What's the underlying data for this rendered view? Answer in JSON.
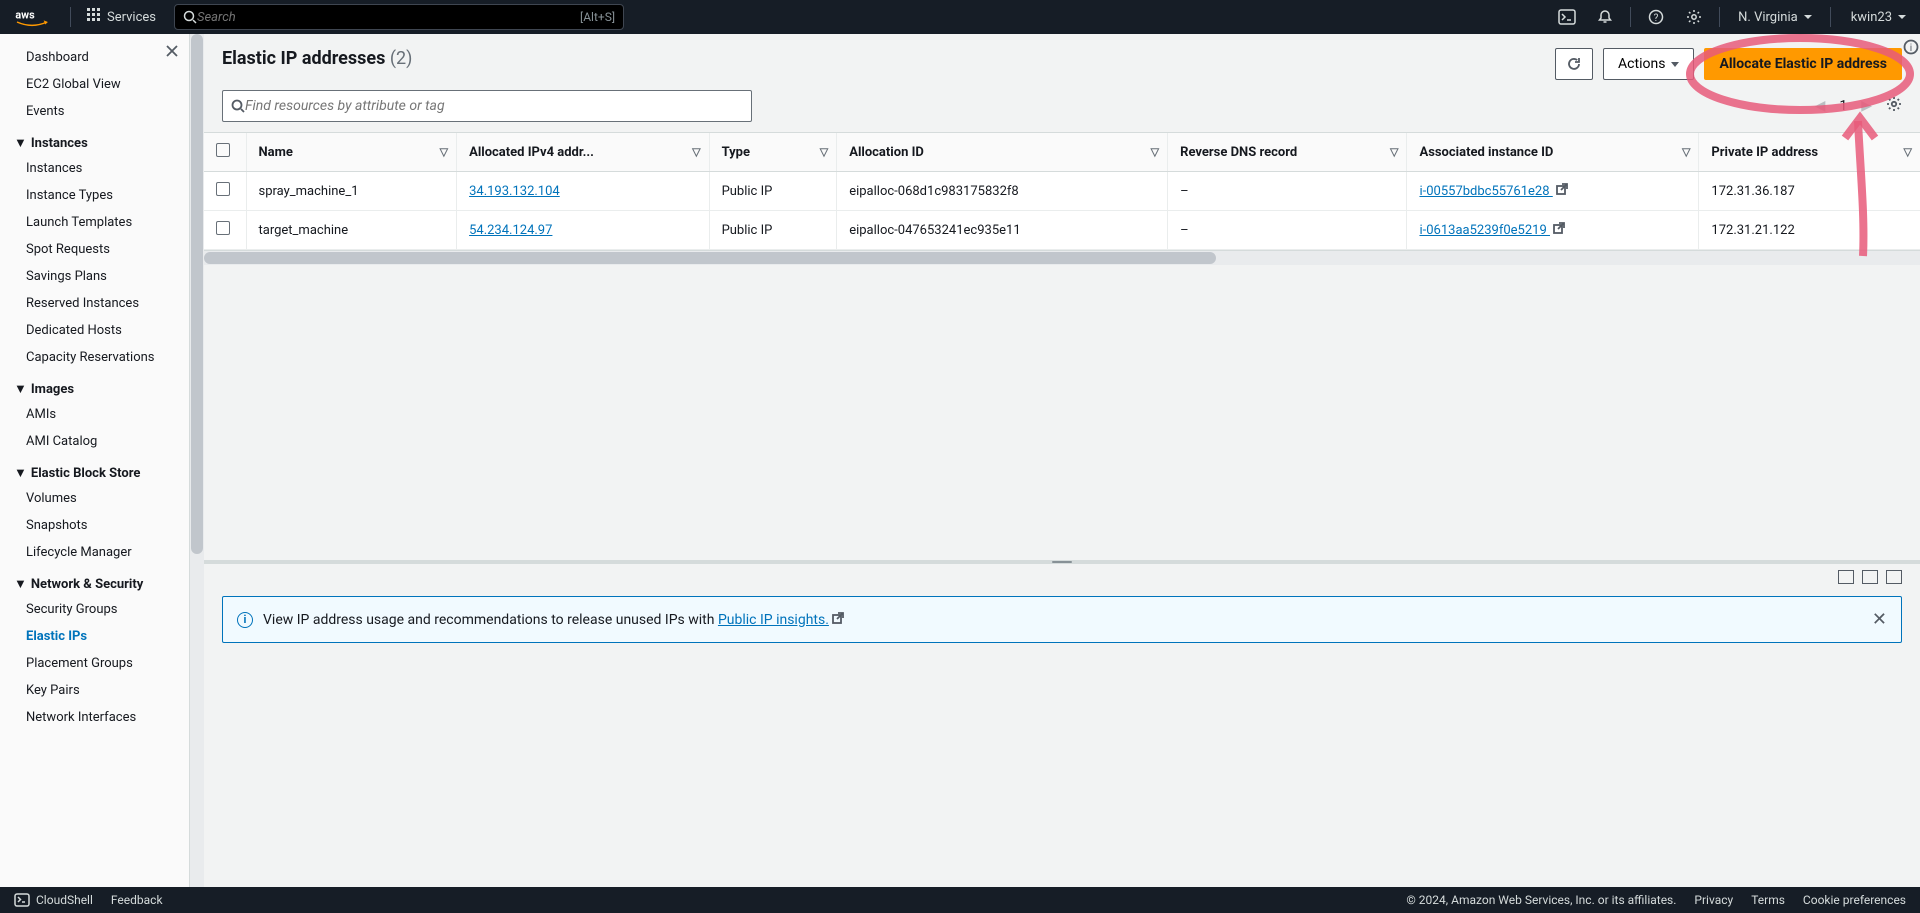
{
  "topnav": {
    "services": "Services",
    "search_placeholder": "Search",
    "search_hint": "[Alt+S]",
    "region": "N. Virginia",
    "user": "kwin23"
  },
  "sidebar": {
    "top": [
      "Dashboard",
      "EC2 Global View",
      "Events"
    ],
    "sections": [
      {
        "label": "Instances",
        "items": [
          "Instances",
          "Instance Types",
          "Launch Templates",
          "Spot Requests",
          "Savings Plans",
          "Reserved Instances",
          "Dedicated Hosts",
          "Capacity Reservations"
        ]
      },
      {
        "label": "Images",
        "items": [
          "AMIs",
          "AMI Catalog"
        ]
      },
      {
        "label": "Elastic Block Store",
        "items": [
          "Volumes",
          "Snapshots",
          "Lifecycle Manager"
        ]
      },
      {
        "label": "Network & Security",
        "items": [
          "Security Groups",
          "Elastic IPs",
          "Placement Groups",
          "Key Pairs",
          "Network Interfaces"
        ],
        "active": "Elastic IPs"
      }
    ]
  },
  "page": {
    "title": "Elastic IP addresses",
    "count": "(2)",
    "actions_label": "Actions",
    "allocate_label": "Allocate Elastic IP address",
    "filter_placeholder": "Find resources by attribute or tag",
    "page_num": "1"
  },
  "columns": [
    "Name",
    "Allocated IPv4 addr...",
    "Type",
    "Allocation ID",
    "Reverse DNS record",
    "Associated instance ID",
    "Private IP address"
  ],
  "rows": [
    {
      "name": "spray_machine_1",
      "ip": "34.193.132.104",
      "type": "Public IP",
      "alloc": "eipalloc-068d1c983175832f8",
      "rdns": "–",
      "instance": "i-00557bdbc55761e28",
      "priv": "172.31.36.187"
    },
    {
      "name": "target_machine",
      "ip": "54.234.124.97",
      "type": "Public IP",
      "alloc": "eipalloc-047653241ec935e11",
      "rdns": "–",
      "instance": "i-0613aa5239f0e5219",
      "priv": "172.31.21.122"
    }
  ],
  "banner": {
    "text": "View IP address usage and recommendations to release unused IPs with ",
    "link": "Public IP insights."
  },
  "footer": {
    "cloudshell": "CloudShell",
    "feedback": "Feedback",
    "copyright": "© 2024, Amazon Web Services, Inc. or its affiliates.",
    "links": [
      "Privacy",
      "Terms",
      "Cookie preferences"
    ]
  }
}
